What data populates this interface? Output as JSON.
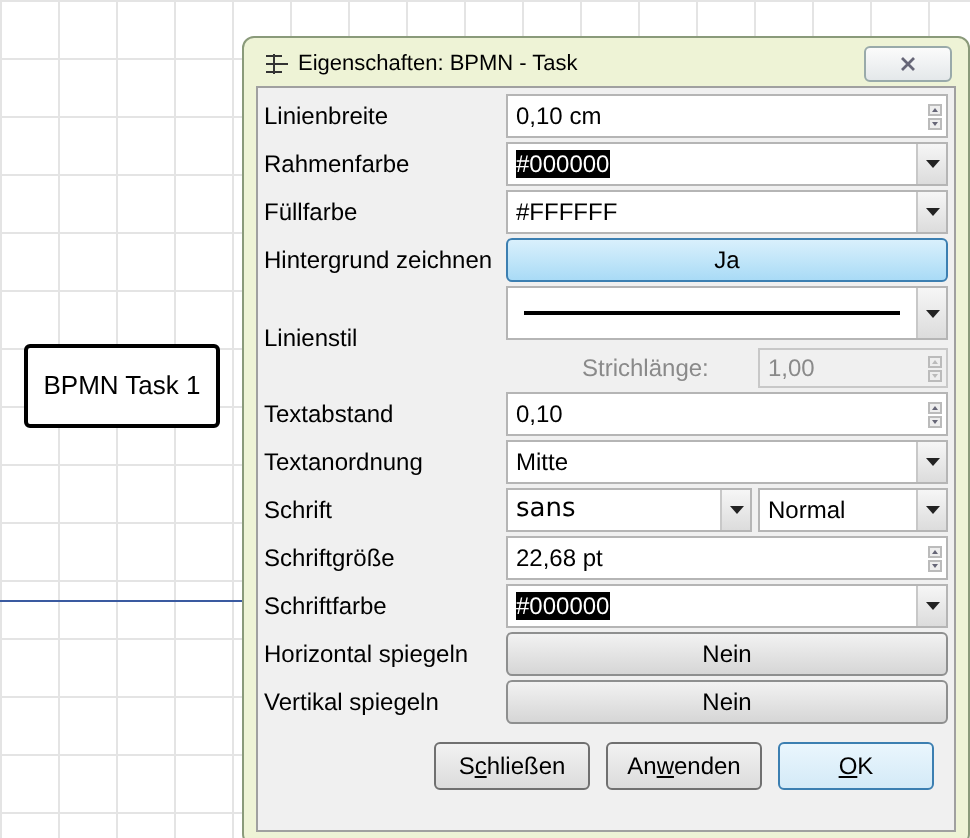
{
  "canvas": {
    "shape_label": "BPMN Task 1"
  },
  "dialog": {
    "title": "Eigenschaften: BPMN - Task",
    "rows": [
      {
        "label": "Linienbreite",
        "kind": "spin",
        "value": "0,10 cm"
      },
      {
        "label": "Rahmenfarbe",
        "kind": "combo",
        "value": "#000000",
        "selected": true
      },
      {
        "label": "Füllfarbe",
        "kind": "combo",
        "value": "#FFFFFF",
        "selected": false
      },
      {
        "label": "Hintergrund zeichnen",
        "kind": "toggle",
        "value": "Ja",
        "on": true
      },
      {
        "label": "Linienstil",
        "kind": "linestyle",
        "sub_label": "Strichlänge:",
        "sub_value": "1,00",
        "disabled": true
      },
      {
        "label": "Textabstand",
        "kind": "spin",
        "value": "0,10"
      },
      {
        "label": "Textanordnung",
        "kind": "combo",
        "value": "Mitte",
        "selected": false
      },
      {
        "label": "Schrift",
        "kind": "font",
        "value": "sans",
        "style": "Normal"
      },
      {
        "label": "Schriftgröße",
        "kind": "spin",
        "value": "22,68 pt"
      },
      {
        "label": "Schriftfarbe",
        "kind": "combo",
        "value": "#000000",
        "selected": true
      },
      {
        "label": "Horizontal spiegeln",
        "kind": "toggle",
        "value": "Nein",
        "on": false
      },
      {
        "label": "Vertikal spiegeln",
        "kind": "toggle",
        "value": "Nein",
        "on": false
      }
    ],
    "buttons": [
      {
        "before": "S",
        "access_key": "c",
        "after": "hließen",
        "default": false
      },
      {
        "before": "An",
        "access_key": "w",
        "after": "enden",
        "default": false
      },
      {
        "access_key": "O",
        "after": "K",
        "default": true
      }
    ]
  }
}
